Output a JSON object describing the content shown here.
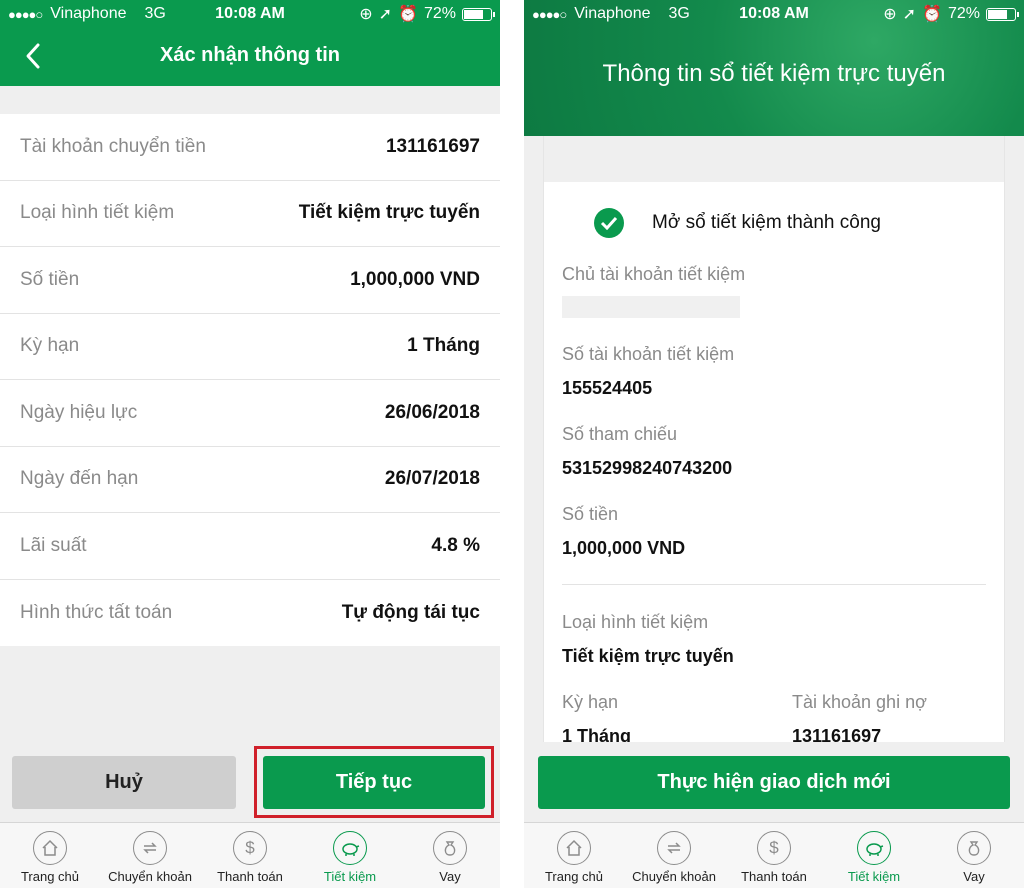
{
  "status_bar": {
    "carrier": "Vinaphone",
    "network": "3G",
    "time": "10:08 AM",
    "battery": "72%",
    "battery_level": 0.72
  },
  "confirm_screen": {
    "title": "Xác nhận thông tin",
    "rows": [
      {
        "label": "Tài khoản chuyển tiền",
        "value": "131161697"
      },
      {
        "label": "Loại hình tiết kiệm",
        "value": "Tiết kiệm trực tuyến"
      },
      {
        "label": "Số tiền",
        "value": "1,000,000 VND"
      },
      {
        "label": "Kỳ hạn",
        "value": "1 Tháng"
      },
      {
        "label": "Ngày hiệu lực",
        "value": "26/06/2018"
      },
      {
        "label": "Ngày đến hạn",
        "value": "26/07/2018"
      },
      {
        "label": "Lãi suất",
        "value": "4.8 %"
      },
      {
        "label": "Hình thức tất toán",
        "value": "Tự động tái tục"
      }
    ],
    "cancel_label": "Huỷ",
    "continue_label": "Tiếp tục"
  },
  "result_screen": {
    "title": "Thông tin sổ tiết kiệm trực tuyến",
    "success_text": "Mở sổ tiết kiệm thành công",
    "owner_label": "Chủ tài khoản tiết kiệm",
    "account_label": "Số tài khoản tiết kiệm",
    "account_value": "155524405",
    "reference_label": "Số tham chiếu",
    "reference_value": "53152998240743200",
    "amount_label": "Số tiền",
    "amount_value": "1,000,000 VND",
    "type_label": "Loại hình tiết kiệm",
    "type_value": "Tiết kiệm trực tuyến",
    "term_label": "Kỳ hạn",
    "term_value": "1 Tháng",
    "debit_label": "Tài khoản ghi nợ",
    "debit_value": "131161697",
    "new_transaction_label": "Thực hiện giao dịch mới"
  },
  "tabs": [
    {
      "label": "Trang chủ",
      "icon": "home-icon"
    },
    {
      "label": "Chuyển khoản",
      "icon": "transfer-icon"
    },
    {
      "label": "Thanh toán",
      "icon": "dollar-icon"
    },
    {
      "label": "Tiết kiệm",
      "icon": "piggy-bank-icon",
      "active": true
    },
    {
      "label": "Vay",
      "icon": "money-bag-icon"
    }
  ],
  "colors": {
    "brand_green": "#0a9a4e",
    "highlight_red": "#d0202a"
  }
}
